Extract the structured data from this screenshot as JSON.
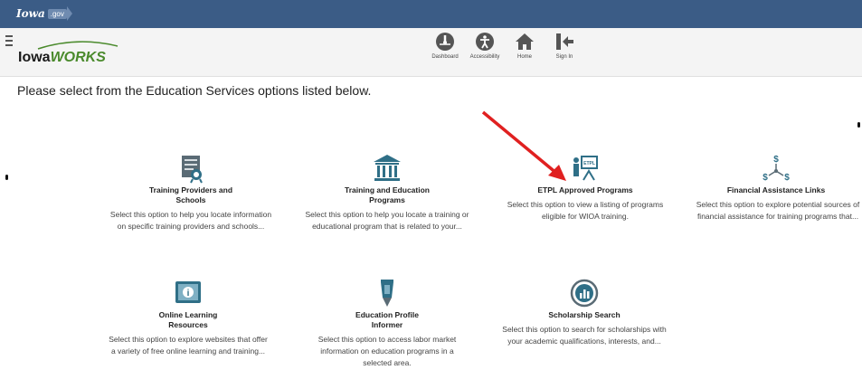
{
  "topbar": {
    "logo_text": "Iowa",
    "logo_tag": ".gov"
  },
  "header": {
    "brand_iowa": "Iowa",
    "brand_works": "WORKS",
    "nav": [
      {
        "label": "Dashboard",
        "icon": "dashboard-icon"
      },
      {
        "label": "Accessibility",
        "icon": "accessibility-icon"
      },
      {
        "label": "Home",
        "icon": "home-icon"
      },
      {
        "label": "Sign In",
        "icon": "sign-in-icon"
      }
    ]
  },
  "page_title": "Please select from the Education Services options listed below.",
  "cards": [
    {
      "title": "Training Providers and Schools",
      "desc": "Select this option to help you locate information on specific training providers and schools...",
      "icon": "training-providers-icon"
    },
    {
      "title": "Training and Education Programs",
      "desc": "Select this option to help you locate a training or educational program that is related to your...",
      "icon": "institution-building-icon"
    },
    {
      "title": "ETPL Approved Programs",
      "desc": "Select this option to view a listing of programs eligible for WIOA training.",
      "icon": "etpl-presentation-icon"
    },
    {
      "title": "Financial Assistance Links",
      "desc": "Select this option to explore potential sources of financial assistance for training programs that...",
      "icon": "financial-network-icon"
    },
    {
      "title": "Online Learning Resources",
      "desc": "Select this option to explore websites that offer a variety of free online learning and training...",
      "icon": "online-learning-icon"
    },
    {
      "title": "Education Profile Informer",
      "desc": "Select this option to access labor market information on education programs in a selected area.",
      "icon": "education-profile-icon"
    },
    {
      "title": "Scholarship Search",
      "desc": "Select this option to search for scholarships with your academic qualifications, interests, and...",
      "icon": "scholarship-search-icon"
    }
  ],
  "colors": {
    "topbar": "#3b5c86",
    "brand_green": "#4a8a2c",
    "icon_teal": "#2f6f87",
    "arrow_red": "#e02020"
  }
}
